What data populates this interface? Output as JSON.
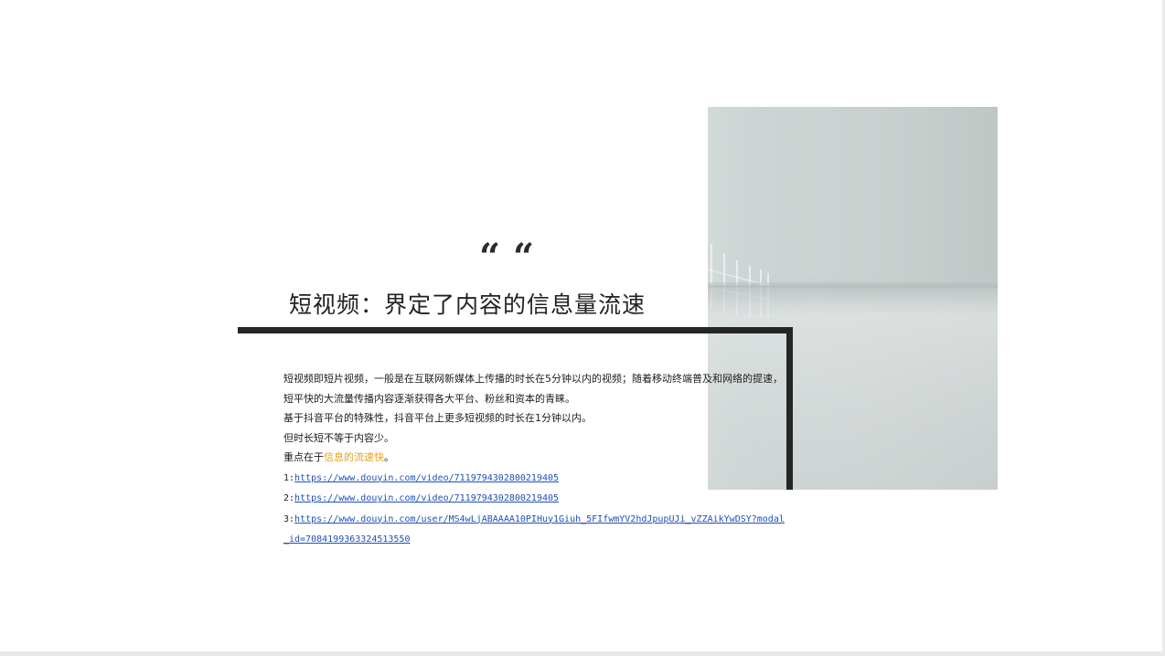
{
  "slide": {
    "quote_mark": "“",
    "title": "短视频：界定了内容的信息量流速"
  },
  "paragraphs": {
    "p1": "短视频即短片视频，一般是在互联网新媒体上传播的时长在5分钟以内的视频；随着移动终端普及和网络的提速，短平快的大流量传播内容逐渐获得各大平台、粉丝和资本的青睐。",
    "p2": "基于抖音平台的特殊性，抖音平台上更多短视频的时长在1分钟以内。",
    "p3": "但时长短不等于内容少。",
    "p4_prefix": "重点在于",
    "p4_highlight": "信息的流速快",
    "p4_suffix": "。"
  },
  "links": [
    {
      "index": "1:",
      "url": "https://www.douyin.com/video/7119794302800219405"
    },
    {
      "index": "2:",
      "url": "https://www.douyin.com/video/7119794302800219405"
    },
    {
      "index": "3:",
      "url": "https://www.douyin.com/user/MS4wLjABAAAA10PIHuy1Giuh_5FIfwmYV2hdJpupUJi_vZZAikYwDSY?modal_id=7084199363324513550"
    }
  ],
  "colors": {
    "highlight": "#e3a21a",
    "link": "#1f4fb5",
    "frame": "#262626"
  }
}
